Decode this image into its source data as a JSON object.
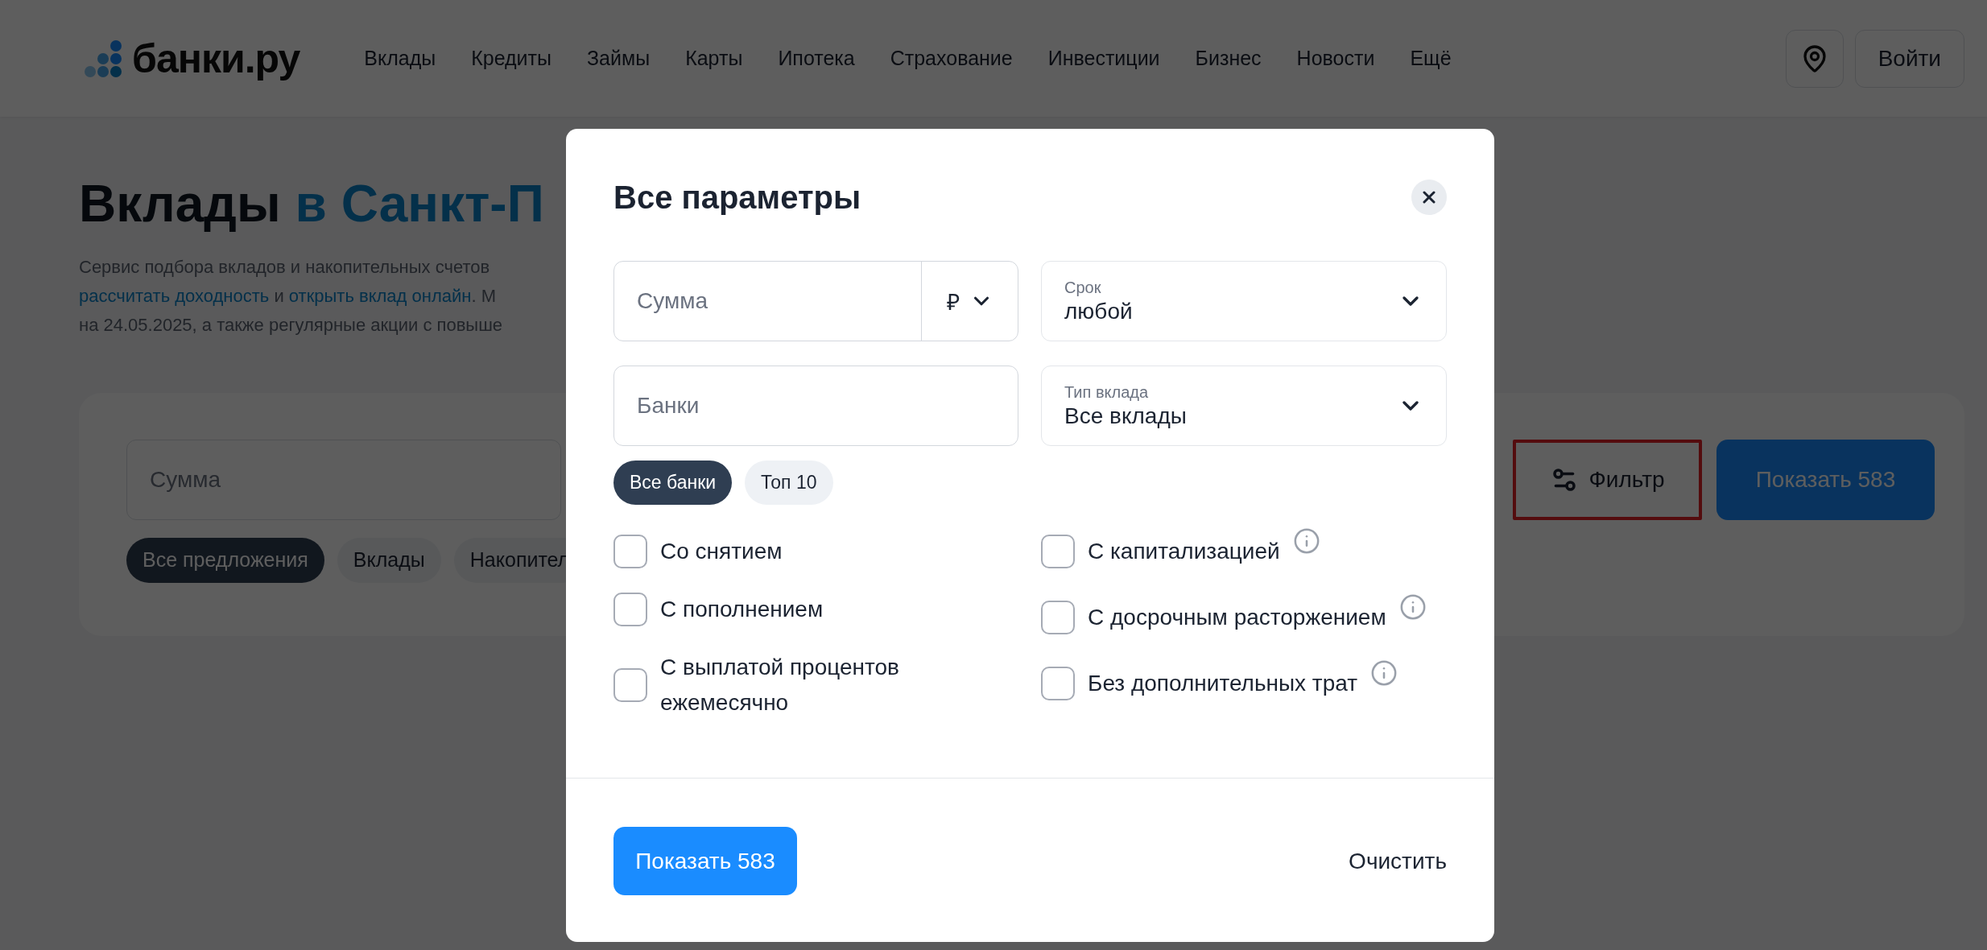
{
  "header": {
    "logo_text": "банки.ру",
    "nav": [
      "Вклады",
      "Кредиты",
      "Займы",
      "Карты",
      "Ипотека",
      "Страхование",
      "Инвестиции",
      "Бизнес",
      "Новости",
      "Ещё"
    ],
    "login_button": "Войти"
  },
  "page": {
    "heading": {
      "main": "Вклады",
      "accent": "в Санкт-П"
    },
    "intro": {
      "line_1": "Сервис подбора вкладов и накопительных счетов",
      "line_2": [
        {
          "kind": "link",
          "text": "рассчитать доходность"
        },
        {
          "kind": "text",
          "text": " и "
        },
        {
          "kind": "link",
          "text": "открыть вклад онлайн"
        },
        {
          "kind": "text",
          "text": ". М"
        }
      ],
      "line_3": "на 24.05.2025, а также регулярные акции с повыше"
    }
  },
  "search_card": {
    "amount_placeholder": "Сумма",
    "chips": [
      {
        "label": "Все предложения",
        "selected": true
      },
      {
        "label": "Вклады",
        "selected": false
      },
      {
        "label": "Накопител",
        "selected": false
      }
    ],
    "filter_button": "Фильтр",
    "show_button": "Показать 583"
  },
  "modal": {
    "title": "Все параметры",
    "amount_placeholder": "Сумма",
    "currency": "₽",
    "term": {
      "label": "Срок",
      "value": "любой"
    },
    "banks_placeholder": "Банки",
    "deposit_type": {
      "label": "Тип вклада",
      "value": "Все вклады"
    },
    "bank_chips": [
      {
        "label": "Все банки",
        "selected": true
      },
      {
        "label": "Топ 10",
        "selected": false
      }
    ],
    "options_left": [
      {
        "label": "Со снятием",
        "checked": false,
        "info": false
      },
      {
        "label": "С пополнением",
        "checked": false,
        "info": false
      },
      {
        "label": "С выплатой процентов ежемесячно",
        "checked": false,
        "info": false
      }
    ],
    "options_right": [
      {
        "label": "С капитализацией",
        "checked": false,
        "info": true
      },
      {
        "label": "С досрочным расторжением",
        "checked": false,
        "info": true
      },
      {
        "label": "Без дополнительных трат",
        "checked": false,
        "info": true
      }
    ],
    "show_button": "Показать 583",
    "clear_button": "Очистить"
  }
}
